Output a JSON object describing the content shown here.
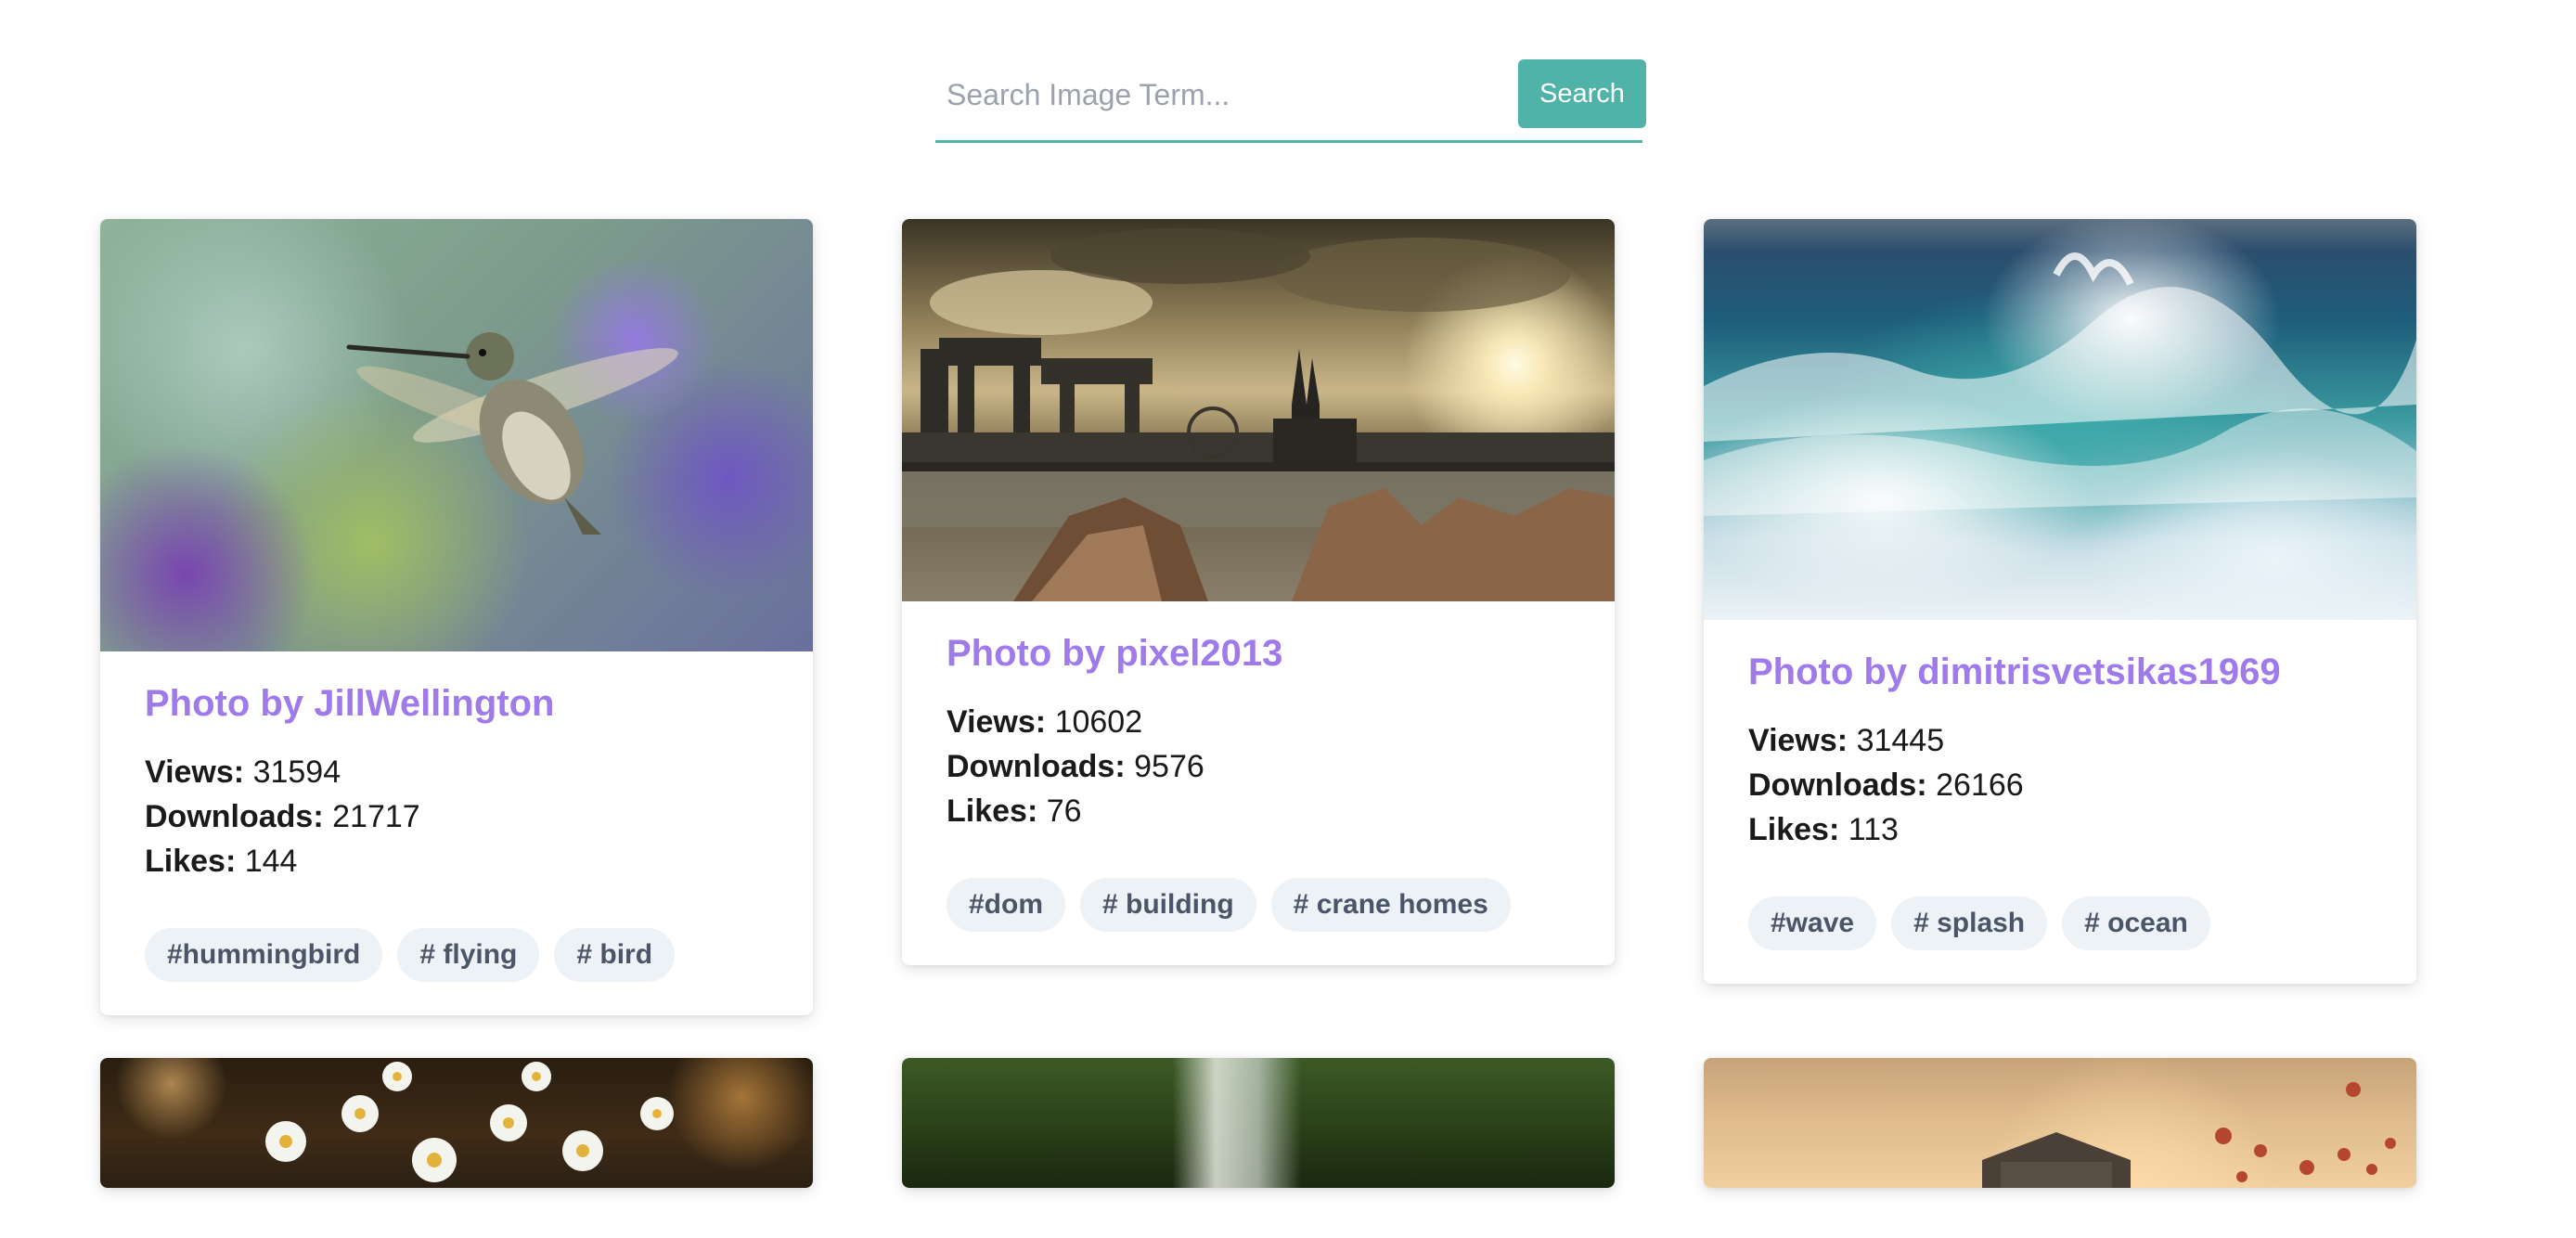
{
  "search": {
    "placeholder": "Search Image Term...",
    "button_label": "Search"
  },
  "cards": [
    {
      "title": "Photo by JillWellington",
      "views_label": "Views:",
      "views": "31594",
      "downloads_label": "Downloads:",
      "downloads": "21717",
      "likes_label": "Likes:",
      "likes": "144",
      "tags": [
        "#hummingbird",
        "# flying",
        "# bird"
      ]
    },
    {
      "title": "Photo by pixel2013",
      "views_label": "Views:",
      "views": "10602",
      "downloads_label": "Downloads:",
      "downloads": "9576",
      "likes_label": "Likes:",
      "likes": "76",
      "tags": [
        "#dom",
        "# building",
        "# crane homes"
      ]
    },
    {
      "title": "Photo by dimitrisvetsikas1969",
      "views_label": "Views:",
      "views": "31445",
      "downloads_label": "Downloads:",
      "downloads": "26166",
      "likes_label": "Likes:",
      "likes": "113",
      "tags": [
        "#wave",
        "# splash",
        "# ocean"
      ]
    }
  ],
  "colors": {
    "accent": "#4fb3a9",
    "title": "#9f7aea",
    "tag_bg": "#edf2f7",
    "tag_text": "#4a5568"
  }
}
